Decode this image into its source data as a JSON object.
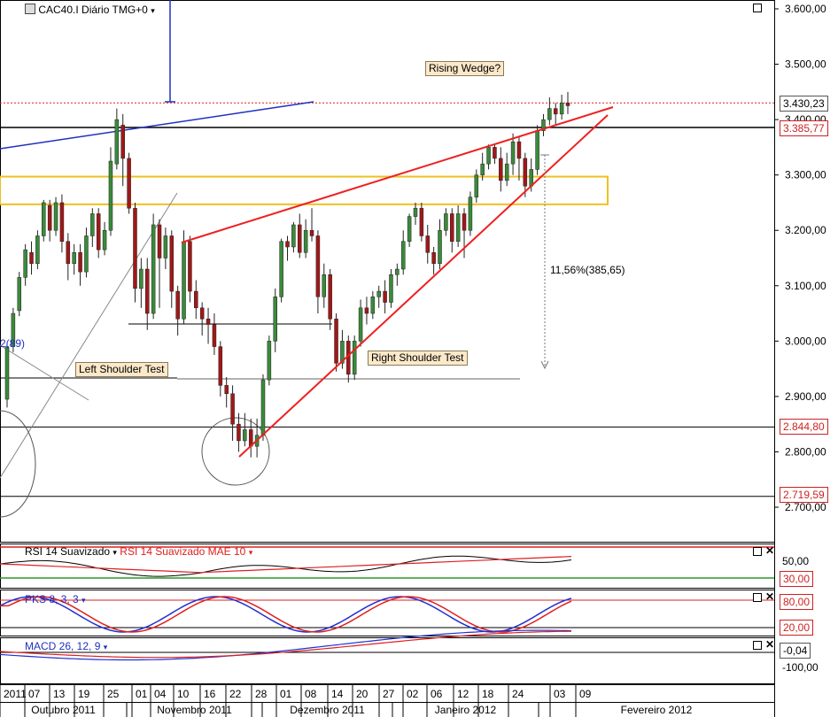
{
  "header": {
    "symbol_label": "CAC40.I Diário TMG+0",
    "dropdown_icon": "chevron-down-icon",
    "chart_icon": "candlestick-chart-icon"
  },
  "annotations": {
    "rising_wedge": "Rising Wedge?",
    "left_shoulder": "Left Shoulder Test",
    "right_shoulder": "Right Shoulder Test",
    "measure": "11,56%(385,65)",
    "partial_left": "2(89)"
  },
  "price_boxes": {
    "last": "3.430,23",
    "level1": "3.385,77",
    "level2": "2.844,80",
    "level3": "2.719,59"
  },
  "indicators": {
    "rsi_label": "RSI 14 Suavizado",
    "rsi_mae_label": "RSI 14 Suavizado MAE 10",
    "rsi_level_50": "50,00",
    "rsi_level_30": "30,00",
    "pks_label": "PKS 8, 3, 3",
    "pks_level_80": "80,00",
    "pks_level_20": "20,00",
    "macd_label": "MACD 26, 12, 9",
    "macd_value": "-0,04",
    "macd_level": "-100,00"
  },
  "colors": {
    "up_candle": "#3a8a3a",
    "down_candle": "#a01818",
    "wedge": "#ee2020",
    "trend_blue": "#2030c0",
    "zone": "#f0c020",
    "resistance_dotted": "#dd2020"
  },
  "chart_data": {
    "type": "candlestick",
    "title": "CAC40.I Diário TMG+0",
    "y_axis": {
      "ticks": [
        "3.600,00",
        "3.500,00",
        "3.400,00",
        "3.300,00",
        "3.200,00",
        "3.100,00",
        "3.000,00",
        "2.900,00",
        "2.800,00",
        "2.700,00"
      ],
      "range": [
        2610,
        3620
      ]
    },
    "x_axis": {
      "day_ticks": [
        "2011",
        "07",
        "13",
        "19",
        "25",
        "01",
        "04",
        "10",
        "16",
        "22",
        "28",
        "01",
        "08",
        "14",
        "20",
        "27",
        "02",
        "06",
        "12",
        "18",
        "24",
        "03",
        "09"
      ],
      "month_labels": [
        "Outubro 2011",
        "Novembro 2011",
        "Dezembro 2011",
        "Janeiro 2012",
        "Fevereiro 2012"
      ]
    },
    "candles": [
      [
        2895,
        2990,
        2880,
        2995
      ],
      [
        2990,
        3050,
        2980,
        3060
      ],
      [
        3055,
        3115,
        3045,
        3125
      ],
      [
        3115,
        3165,
        3100,
        3175
      ],
      [
        3160,
        3140,
        3120,
        3180
      ],
      [
        3140,
        3190,
        3130,
        3200
      ],
      [
        3190,
        3250,
        3180,
        3255
      ],
      [
        3245,
        3200,
        3180,
        3255
      ],
      [
        3200,
        3250,
        3190,
        3260
      ],
      [
        3250,
        3180,
        3160,
        3265
      ],
      [
        3180,
        3140,
        3110,
        3195
      ],
      [
        3140,
        3160,
        3120,
        3175
      ],
      [
        3160,
        3125,
        3100,
        3175
      ],
      [
        3125,
        3190,
        3115,
        3205
      ],
      [
        3190,
        3230,
        3170,
        3240
      ],
      [
        3230,
        3165,
        3150,
        3240
      ],
      [
        3165,
        3200,
        3155,
        3215
      ],
      [
        3200,
        3325,
        3190,
        3350
      ],
      [
        3320,
        3400,
        3310,
        3420
      ],
      [
        3390,
        3330,
        3280,
        3410
      ],
      [
        3330,
        3240,
        3230,
        3340
      ],
      [
        3240,
        3095,
        3070,
        3250
      ],
      [
        3095,
        3130,
        3060,
        3150
      ],
      [
        3130,
        3050,
        3020,
        3150
      ],
      [
        3050,
        3210,
        3040,
        3230
      ],
      [
        3210,
        3150,
        3060,
        3220
      ],
      [
        3150,
        3190,
        3130,
        3205
      ],
      [
        3190,
        3090,
        3060,
        3200
      ],
      [
        3090,
        3040,
        3010,
        3100
      ],
      [
        3040,
        3180,
        3030,
        3200
      ],
      [
        3180,
        3090,
        3070,
        3190
      ],
      [
        3090,
        3060,
        3040,
        3110
      ],
      [
        3060,
        3040,
        3010,
        3070
      ],
      [
        3040,
        3030,
        2995,
        3060
      ],
      [
        3030,
        2990,
        2975,
        3050
      ],
      [
        2990,
        2920,
        2900,
        3000
      ],
      [
        2920,
        2905,
        2880,
        2935
      ],
      [
        2905,
        2850,
        2820,
        2920
      ],
      [
        2850,
        2820,
        2800,
        2870
      ],
      [
        2820,
        2840,
        2810,
        2870
      ],
      [
        2840,
        2810,
        2790,
        2860
      ],
      [
        2810,
        2830,
        2790,
        2860
      ],
      [
        2830,
        2930,
        2820,
        2940
      ],
      [
        2930,
        3000,
        2920,
        3010
      ],
      [
        3000,
        3080,
        2980,
        3095
      ],
      [
        3080,
        3180,
        3070,
        3185
      ],
      [
        3180,
        3170,
        3145,
        3190
      ],
      [
        3170,
        3210,
        3160,
        3215
      ],
      [
        3210,
        3160,
        3150,
        3230
      ],
      [
        3160,
        3200,
        3150,
        3220
      ],
      [
        3200,
        3190,
        3180,
        3240
      ],
      [
        3190,
        3080,
        3050,
        3200
      ],
      [
        3080,
        3120,
        3060,
        3140
      ],
      [
        3120,
        3040,
        3020,
        3130
      ],
      [
        3040,
        2960,
        2945,
        3050
      ],
      [
        2960,
        3000,
        2950,
        3020
      ],
      [
        3000,
        2940,
        2925,
        3010
      ],
      [
        2940,
        3000,
        2930,
        3010
      ],
      [
        3000,
        3060,
        2990,
        3075
      ],
      [
        3060,
        3050,
        3030,
        3080
      ],
      [
        3050,
        3080,
        3040,
        3090
      ],
      [
        3080,
        3090,
        3060,
        3100
      ],
      [
        3090,
        3070,
        3050,
        3110
      ],
      [
        3070,
        3120,
        3060,
        3130
      ],
      [
        3120,
        3130,
        3100,
        3140
      ],
      [
        3130,
        3180,
        3120,
        3200
      ],
      [
        3180,
        3225,
        3170,
        3230
      ],
      [
        3225,
        3240,
        3210,
        3250
      ],
      [
        3240,
        3190,
        3180,
        3250
      ],
      [
        3190,
        3160,
        3140,
        3210
      ],
      [
        3160,
        3140,
        3120,
        3170
      ],
      [
        3140,
        3200,
        3130,
        3220
      ],
      [
        3200,
        3230,
        3190,
        3240
      ],
      [
        3230,
        3180,
        3160,
        3240
      ],
      [
        3180,
        3230,
        3170,
        3245
      ],
      [
        3230,
        3200,
        3150,
        3240
      ],
      [
        3200,
        3260,
        3190,
        3270
      ],
      [
        3260,
        3300,
        3250,
        3310
      ],
      [
        3300,
        3320,
        3290,
        3340
      ],
      [
        3320,
        3350,
        3310,
        3355
      ],
      [
        3350,
        3330,
        3320,
        3355
      ],
      [
        3330,
        3290,
        3270,
        3350
      ],
      [
        3290,
        3320,
        3280,
        3340
      ],
      [
        3320,
        3360,
        3300,
        3375
      ],
      [
        3360,
        3330,
        3290,
        3370
      ],
      [
        3330,
        3280,
        3260,
        3340
      ],
      [
        3280,
        3310,
        3270,
        3330
      ],
      [
        3310,
        3380,
        3300,
        3390
      ],
      [
        3380,
        3400,
        3370,
        3410
      ],
      [
        3400,
        3420,
        3390,
        3440
      ],
      [
        3420,
        3410,
        3390,
        3430
      ],
      [
        3410,
        3430,
        3400,
        3445
      ],
      [
        3430,
        3425,
        3410,
        3450
      ]
    ],
    "levels": {
      "dotted_resistance": 3430.23,
      "black_line": 3385.77,
      "line_2844": 2844.8,
      "line_2719": 2719.59
    },
    "zone": [
      3247,
      3297
    ]
  }
}
